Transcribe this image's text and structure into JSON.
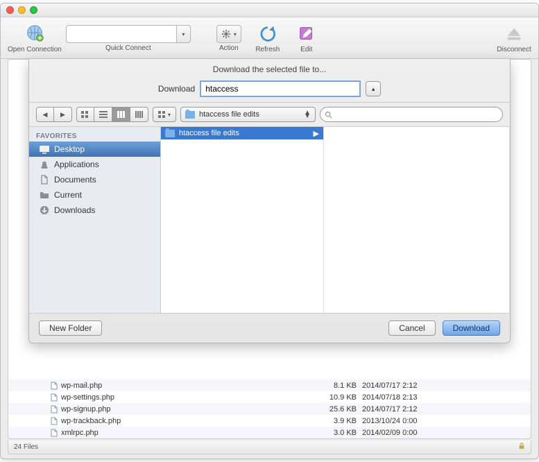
{
  "toolbar": {
    "open_connection": "Open Connection",
    "quick_connect": "Quick Connect",
    "action": "Action",
    "refresh": "Refresh",
    "edit": "Edit",
    "disconnect": "Disconnect"
  },
  "sheet": {
    "title": "Download the selected file to...",
    "field_label": "Download",
    "filename": "htaccess",
    "location": "htaccess file edits",
    "search_placeholder": "",
    "sidebar": {
      "header": "FAVORITES",
      "items": [
        "Desktop",
        "Applications",
        "Documents",
        "Current",
        "Downloads"
      ]
    },
    "column1": {
      "item": "htaccess file edits"
    },
    "new_folder": "New Folder",
    "cancel": "Cancel",
    "download": "Download"
  },
  "files": [
    {
      "name": "wp-mail.php",
      "size": "8.1 KB",
      "date": "2014/07/17 2:12"
    },
    {
      "name": "wp-settings.php",
      "size": "10.9 KB",
      "date": "2014/07/18 2:13"
    },
    {
      "name": "wp-signup.php",
      "size": "25.6 KB",
      "date": "2014/07/17 2:12"
    },
    {
      "name": "wp-trackback.php",
      "size": "3.9 KB",
      "date": "2013/10/24 0:00"
    },
    {
      "name": "xmlrpc.php",
      "size": "3.0 KB",
      "date": "2014/02/09 0:00"
    }
  ],
  "status": {
    "count": "24 Files"
  }
}
